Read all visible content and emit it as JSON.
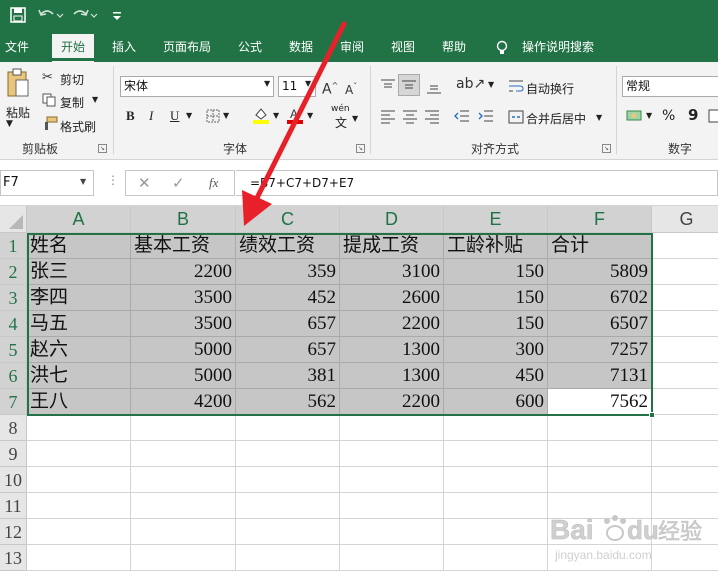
{
  "quick_access": {
    "save_icon": "save-icon",
    "undo_icon": "undo-icon",
    "redo_icon": "redo-icon",
    "customize_icon": "customize-icon"
  },
  "tabs": [
    {
      "label": "文件"
    },
    {
      "label": "开始"
    },
    {
      "label": "插入"
    },
    {
      "label": "页面布局"
    },
    {
      "label": "公式"
    },
    {
      "label": "数据"
    },
    {
      "label": "审阅"
    },
    {
      "label": "视图"
    },
    {
      "label": "帮助"
    },
    {
      "label": "操作说明搜索"
    }
  ],
  "ribbon": {
    "clipboard": {
      "paste": "粘贴",
      "cut": "剪切",
      "copy": "复制",
      "format_painter": "格式刷",
      "group": "剪贴板"
    },
    "font": {
      "name": "宋体",
      "size": "11",
      "bold": "B",
      "italic": "I",
      "underline": "U",
      "group": "字体",
      "wen": "wén"
    },
    "alignment": {
      "wrap": "自动换行",
      "merge": "合并后居中",
      "group": "对齐方式"
    },
    "number": {
      "format": "常规",
      "percent": "%",
      "comma": "9",
      "group": "数字"
    }
  },
  "formula_bar": {
    "name_box": "F7",
    "fx": "fx",
    "formula": "=B7+C7+D7+E7"
  },
  "columns": [
    "A",
    "B",
    "C",
    "D",
    "E",
    "F",
    "G"
  ],
  "rows": [
    "1",
    "2",
    "3",
    "4",
    "5",
    "6",
    "7",
    "8",
    "9",
    "10",
    "11",
    "12",
    "13"
  ],
  "table": {
    "header": [
      "姓名",
      "基本工资",
      "绩效工资",
      "提成工资",
      "工龄补贴",
      "合计"
    ],
    "rows": [
      [
        "张三",
        "2200",
        "359",
        "3100",
        "150",
        "5809"
      ],
      [
        "李四",
        "3500",
        "452",
        "2600",
        "150",
        "6702"
      ],
      [
        "马五",
        "3500",
        "657",
        "2200",
        "150",
        "6507"
      ],
      [
        "赵六",
        "5000",
        "657",
        "1300",
        "300",
        "7257"
      ],
      [
        "洪七",
        "5000",
        "381",
        "1300",
        "450",
        "7131"
      ],
      [
        "王八",
        "4200",
        "562",
        "2200",
        "600",
        "7562"
      ]
    ]
  },
  "watermark": {
    "brand": "Bai",
    "du": "du",
    "jingyan": "经验",
    "url": "jingyan.baidu.com"
  },
  "colors": {
    "excel_green": "#217346",
    "selection_gray": "#c6c6c6",
    "arrow_red": "#e8202a"
  }
}
